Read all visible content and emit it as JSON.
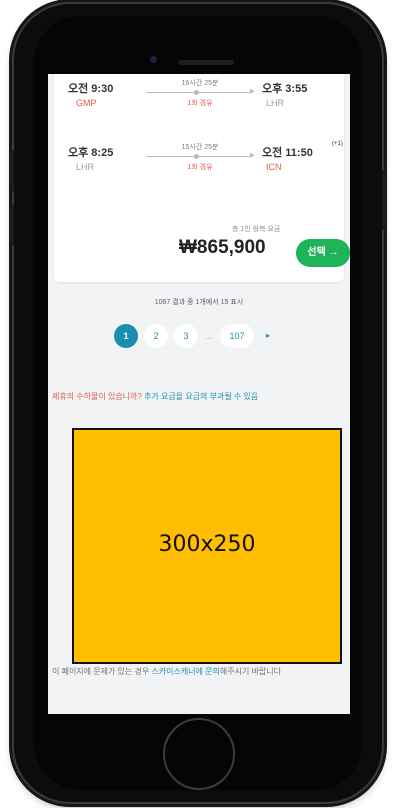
{
  "flight": {
    "outbound": {
      "depart_time": "오전 9:30",
      "depart_code": "GMP",
      "duration": "16시간 25분",
      "stops": "1회 경유",
      "arrive_time": "오후 3:55",
      "arrive_code": "LHR"
    },
    "return": {
      "depart_time": "오후 8:25",
      "depart_code": "LHR",
      "duration": "15시간 25분",
      "stops": "1회 경유",
      "arrive_time": "오전 11:50",
      "arrive_day_offset": "(+1)",
      "arrive_code": "ICN"
    },
    "tax_note": "총 1인 왕복 요금",
    "price": "₩865,900",
    "select_label": "선택 →"
  },
  "results": {
    "summary": "1067 결과 중 1개에서 15 표시"
  },
  "pagination": {
    "pages": [
      "1",
      "2",
      "3",
      "...",
      "107",
      "▸"
    ]
  },
  "feedback": {
    "question": "제휴의 수하물이 있습니까? ",
    "link": "추가 요금을 요금의 부과될 수 있음"
  },
  "ad": {
    "label": "300x250"
  },
  "report": {
    "text": "이 페이지에 문제가 있는 경우 ",
    "link": "스카이스캐너에 문의",
    "suffix": "해주시기 바랍니다"
  },
  "colors": {
    "accent_blue": "#1a8fb0",
    "select_green": "#1fb35a",
    "stop_red": "#e0584f",
    "ad_yellow": "#ffbf00"
  }
}
